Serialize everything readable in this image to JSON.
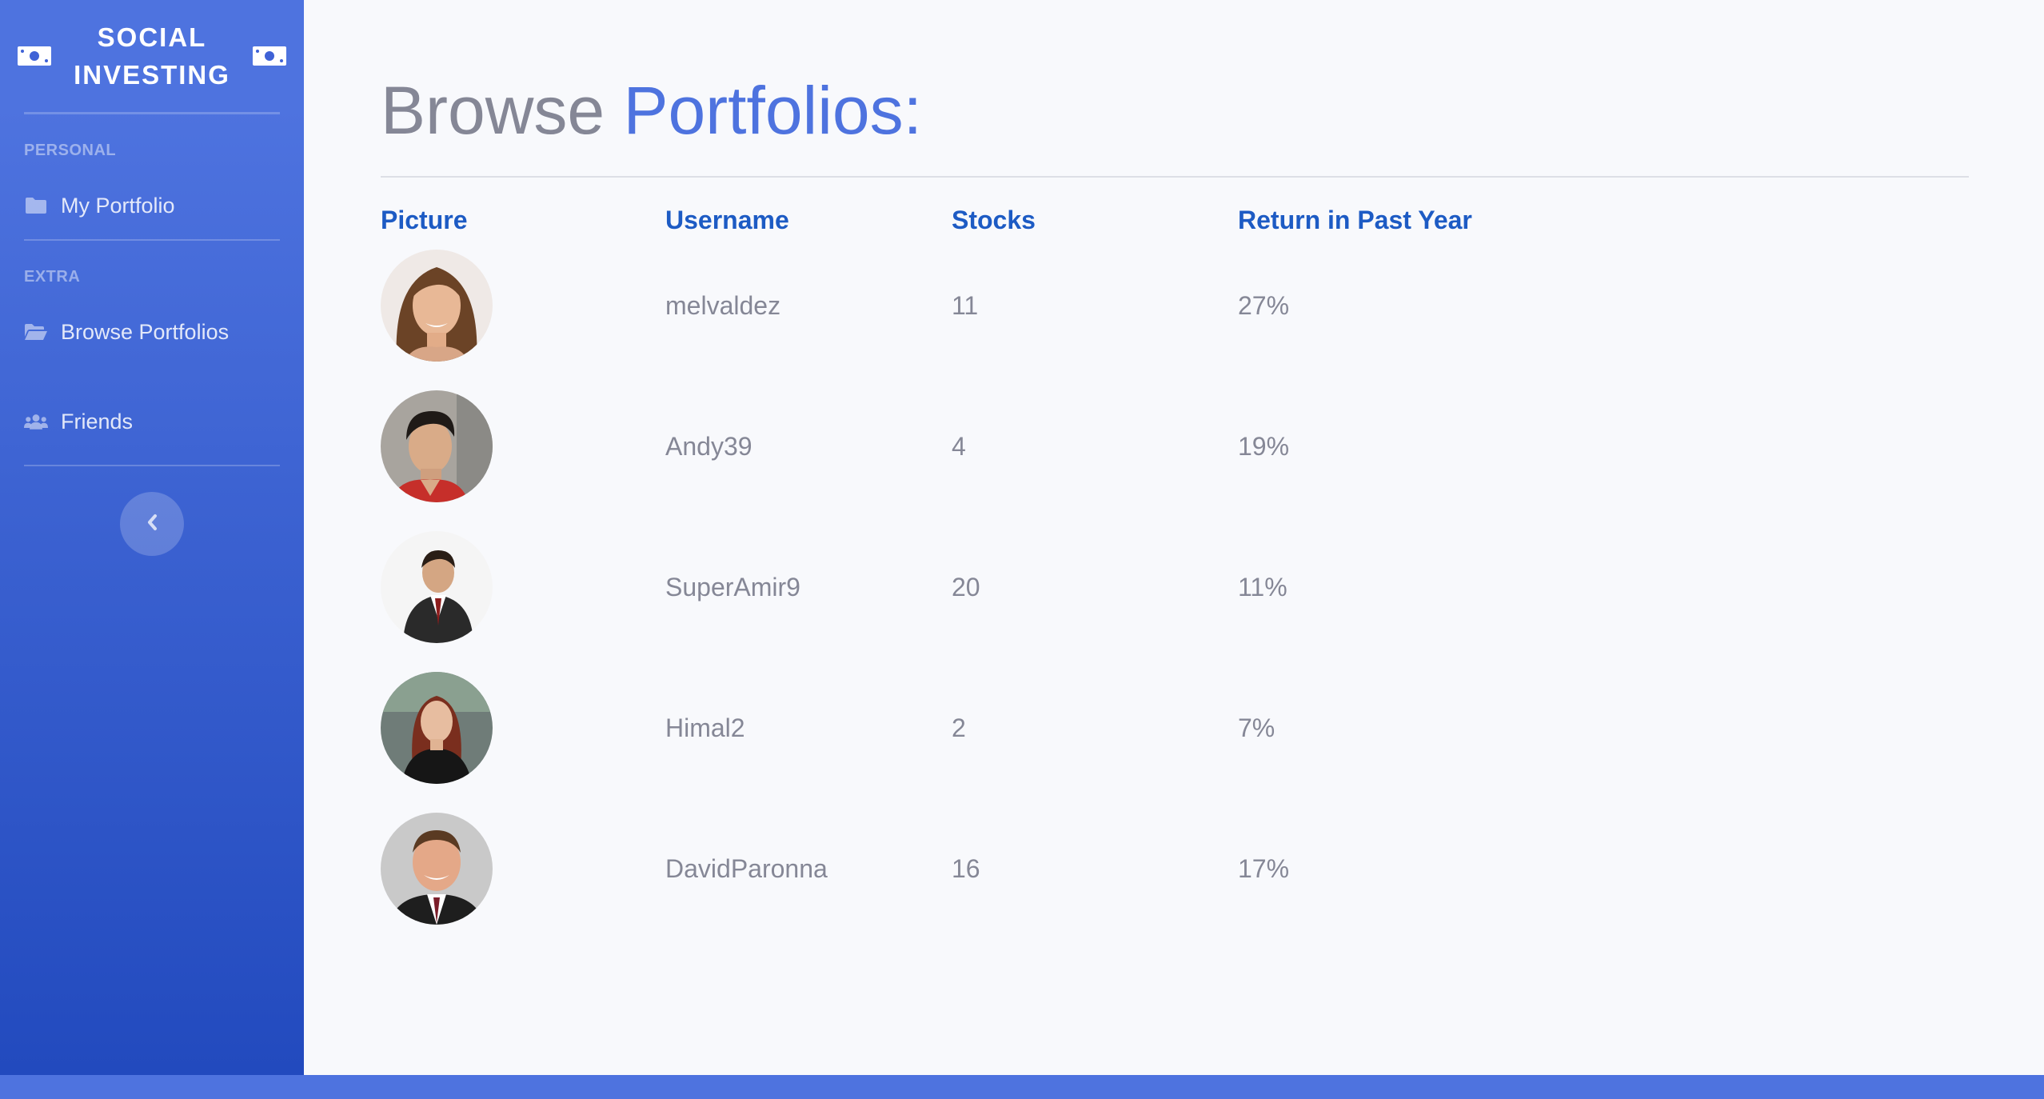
{
  "sidebar": {
    "brand": {
      "line1": "SOCIAL",
      "line2": "INVESTING"
    },
    "sections": [
      {
        "heading": "PERSONAL",
        "items": [
          {
            "label": "My Portfolio",
            "icon": "folder-icon"
          }
        ]
      },
      {
        "heading": "EXTRA",
        "items": [
          {
            "label": "Browse Portfolios",
            "icon": "folder-open-icon"
          },
          {
            "label": "Friends",
            "icon": "users-icon"
          }
        ]
      }
    ],
    "toggle_icon": "chevron-left-icon"
  },
  "main": {
    "title_plain": "Browse ",
    "title_accent": "Portfolios:",
    "table": {
      "columns": [
        "Picture",
        "Username",
        "Stocks",
        "Return in Past Year"
      ],
      "rows": [
        {
          "username": "melvaldez",
          "stocks": "11",
          "return": "27%"
        },
        {
          "username": "Andy39",
          "stocks": "4",
          "return": "19%"
        },
        {
          "username": "SuperAmir9",
          "stocks": "20",
          "return": "11%"
        },
        {
          "username": "Himal2",
          "stocks": "2",
          "return": "7%"
        },
        {
          "username": "DavidParonna",
          "stocks": "16",
          "return": "17%"
        }
      ]
    }
  },
  "colors": {
    "accent": "#4e73df",
    "sidebar_gradient_end": "#224abe",
    "header_text": "#1d5bc4",
    "muted_text": "#858796"
  }
}
